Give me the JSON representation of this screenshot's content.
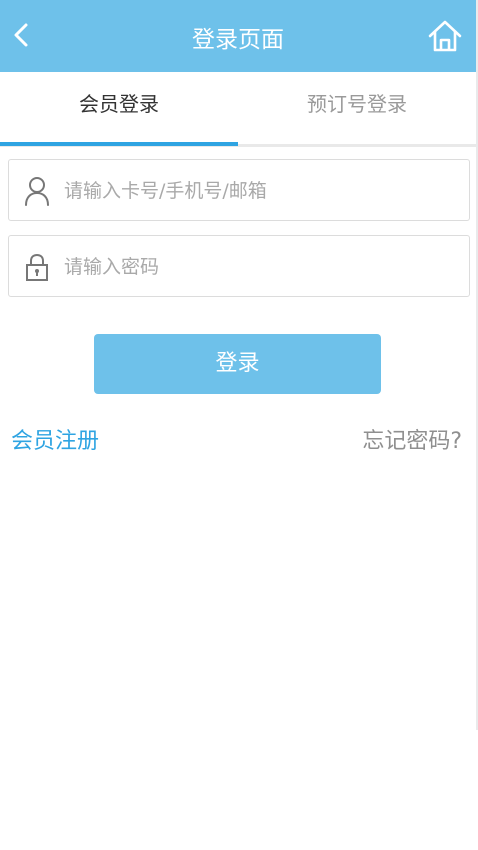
{
  "header": {
    "title": "登录页面",
    "back_icon": "chevron-left-icon",
    "home_icon": "home-icon",
    "background": "#6ec1ea"
  },
  "tabs": [
    {
      "label": "会员登录",
      "active": true
    },
    {
      "label": "预订号登录",
      "active": false
    }
  ],
  "form": {
    "account_placeholder": "请输入卡号/手机号/邮箱",
    "account_value": "",
    "account_icon": "user-icon",
    "password_placeholder": "请输入密码",
    "password_value": "",
    "password_icon": "lock-icon",
    "login_label": "登录"
  },
  "links": {
    "register": "会员注册",
    "forgot": "忘记密码?"
  },
  "colors": {
    "accent": "#2fa4e2",
    "button": "#6ec1ea"
  }
}
